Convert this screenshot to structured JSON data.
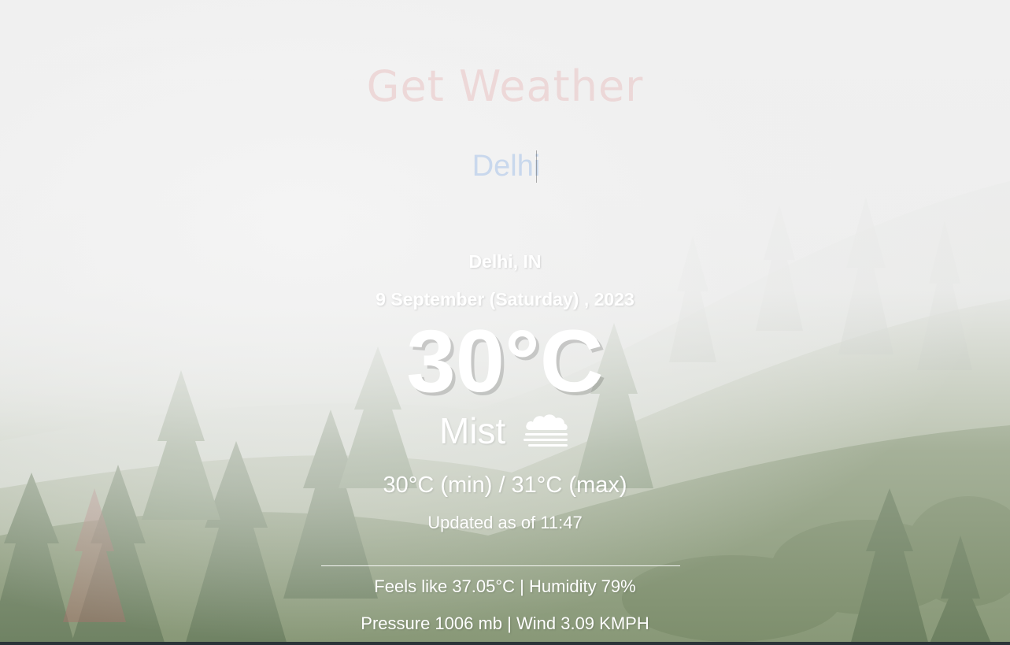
{
  "app": {
    "title": "Get Weather"
  },
  "search": {
    "value": "Delhi",
    "placeholder": ""
  },
  "weather": {
    "location": "Delhi, IN",
    "date": "9 September (Saturday) , 2023",
    "temperature": "30°C",
    "condition": "Mist",
    "condition_icon": "mist-icon",
    "min_max": "30°C (min) / 31°C (max)",
    "updated": "Updated as of 11:47",
    "feels_humidity": "Feels like 37.05°C | Humidity 79%",
    "pressure_wind": "Pressure 1006 mb | Wind 3.09 KMPH"
  },
  "colors": {
    "title": "#e29696",
    "input_text": "#96b9e6",
    "text": "#ffffff"
  }
}
